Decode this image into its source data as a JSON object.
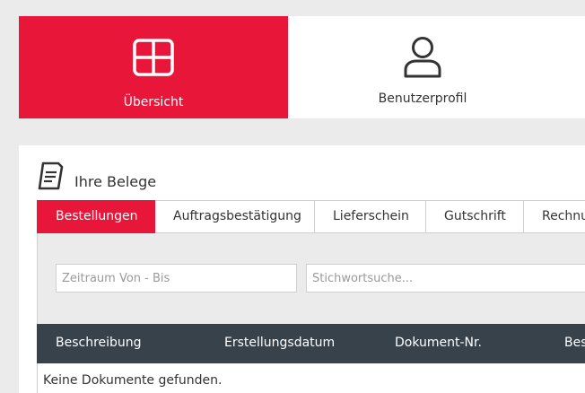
{
  "nav": {
    "tiles": [
      {
        "label": "Übersicht",
        "icon": "grid-icon",
        "active": true
      },
      {
        "label": "Benutzerprofil",
        "icon": "user-icon",
        "active": false
      }
    ]
  },
  "documents": {
    "title": "Ihre Belege",
    "icon": "document-icon",
    "tabs": [
      {
        "label": "Bestellungen",
        "active": true
      },
      {
        "label": "Auftragsbestätigung"
      },
      {
        "label": "Lieferschein"
      },
      {
        "label": "Gutschrift"
      },
      {
        "label": "Rechnu"
      }
    ],
    "filters": {
      "date_range_placeholder": "Zeitraum Von - Bis",
      "keyword_placeholder": "Stichwortsuche..."
    },
    "table": {
      "columns": [
        "Beschreibung",
        "Erstellungsdatum",
        "Dokument-Nr.",
        "Bes"
      ],
      "empty_message": "Keine Dokumente gefunden."
    }
  },
  "colors": {
    "accent": "#e8173a",
    "table_header": "#37424a",
    "background": "#ebebeb"
  }
}
